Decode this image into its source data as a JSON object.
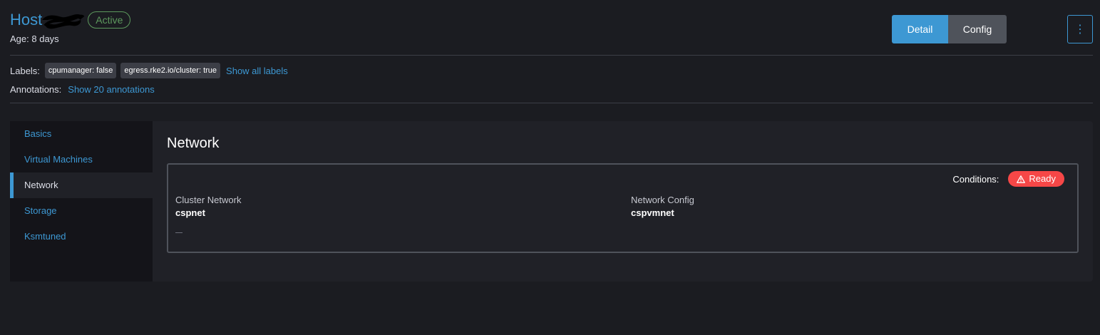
{
  "header": {
    "title": "Host",
    "status": "Active",
    "age_label": "Age:",
    "age_value": "8 days",
    "buttons": {
      "detail": "Detail",
      "config": "Config",
      "menu_icon": "⋮"
    }
  },
  "labels": {
    "label": "Labels:",
    "tags": [
      "cpumanager: false",
      "egress.rke2.io/cluster: true"
    ],
    "show_all": "Show all labels"
  },
  "annotations": {
    "label": "Annotations:",
    "show": "Show 20 annotations"
  },
  "side_nav": {
    "items": [
      {
        "label": "Basics",
        "active": false
      },
      {
        "label": "Virtual Machines",
        "active": false
      },
      {
        "label": "Network",
        "active": true
      },
      {
        "label": "Storage",
        "active": false
      },
      {
        "label": "Ksmtuned",
        "active": false
      }
    ]
  },
  "network": {
    "title": "Network",
    "conditions_label": "Conditions:",
    "condition_status": "Ready",
    "cluster_network_label": "Cluster Network",
    "cluster_network_value": "cspnet",
    "network_config_label": "Network Config",
    "network_config_value": "cspvmnet"
  },
  "colors": {
    "accent": "#3d98d3",
    "active_status": "#5d995d",
    "error": "#f64747",
    "background": "#1b1c21"
  },
  "icons": {
    "warning": "warning-icon",
    "menu": "kebab-menu-icon"
  }
}
